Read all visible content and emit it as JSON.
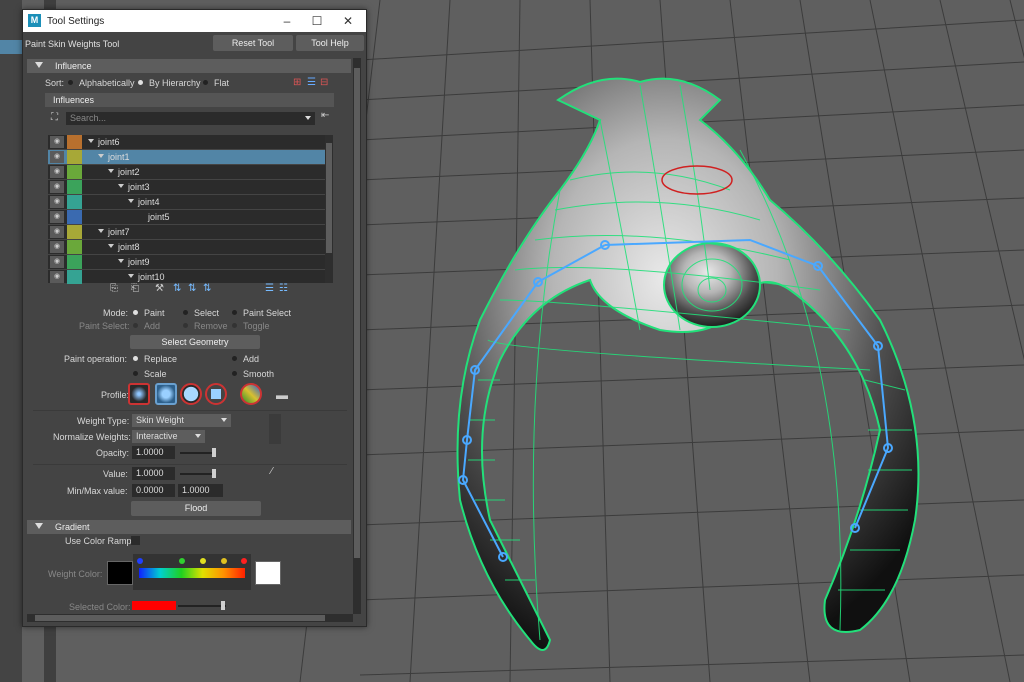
{
  "window": {
    "title": "Tool Settings"
  },
  "header": {
    "tool_name": "Paint Skin Weights Tool",
    "reset_label": "Reset Tool",
    "help_label": "Tool Help"
  },
  "influence": {
    "section_label": "Influence",
    "sort_label": "Sort:",
    "sort_options": [
      "Alphabetically",
      "By Hierarchy",
      "Flat"
    ],
    "sort_selected": "By Hierarchy",
    "influences_label": "Influences",
    "search_placeholder": "Search...",
    "joints": [
      {
        "name": "joint6",
        "color": "#b8702e"
      },
      {
        "name": "joint1",
        "color": "#a7a837"
      },
      {
        "name": "joint2",
        "color": "#6aa83a"
      },
      {
        "name": "joint3",
        "color": "#3ba35b"
      },
      {
        "name": "joint4",
        "color": "#35a393"
      },
      {
        "name": "joint5",
        "color": "#3a6ab0"
      },
      {
        "name": "joint7",
        "color": "#a7a837"
      },
      {
        "name": "joint8",
        "color": "#6aa83a"
      },
      {
        "name": "joint9",
        "color": "#3ba35b"
      },
      {
        "name": "joint10",
        "color": "#35a393"
      }
    ],
    "selected_joint": "joint1"
  },
  "mode": {
    "mode_label": "Mode:",
    "paint": "Paint",
    "select": "Select",
    "paint_select": "Paint Select",
    "paint_select_label": "Paint Select:",
    "add": "Add",
    "remove": "Remove",
    "toggle": "Toggle",
    "select_geometry": "Select Geometry",
    "paint_operation_label": "Paint operation:",
    "op_replace": "Replace",
    "op_add": "Add",
    "op_scale": "Scale",
    "op_smooth": "Smooth",
    "profile_label": "Profile:"
  },
  "weights": {
    "weight_type_label": "Weight Type:",
    "weight_type_value": "Skin Weight",
    "normalize_label": "Normalize Weights:",
    "normalize_value": "Interactive",
    "opacity_label": "Opacity:",
    "opacity_value": "1.0000",
    "opacity_fraction": 1.0,
    "value_label": "Value:",
    "value_value": "1.0000",
    "value_fraction": 1.0,
    "minmax_label": "Min/Max value:",
    "min_value": "0.0000",
    "max_value": "1.0000",
    "flood_label": "Flood"
  },
  "gradient": {
    "section_label": "Gradient",
    "use_color_ramp_label": "Use Color Ramp",
    "weight_color_label": "Weight Color:",
    "selected_color_label": "Selected Color:",
    "selected_color": "#ff0000"
  }
}
